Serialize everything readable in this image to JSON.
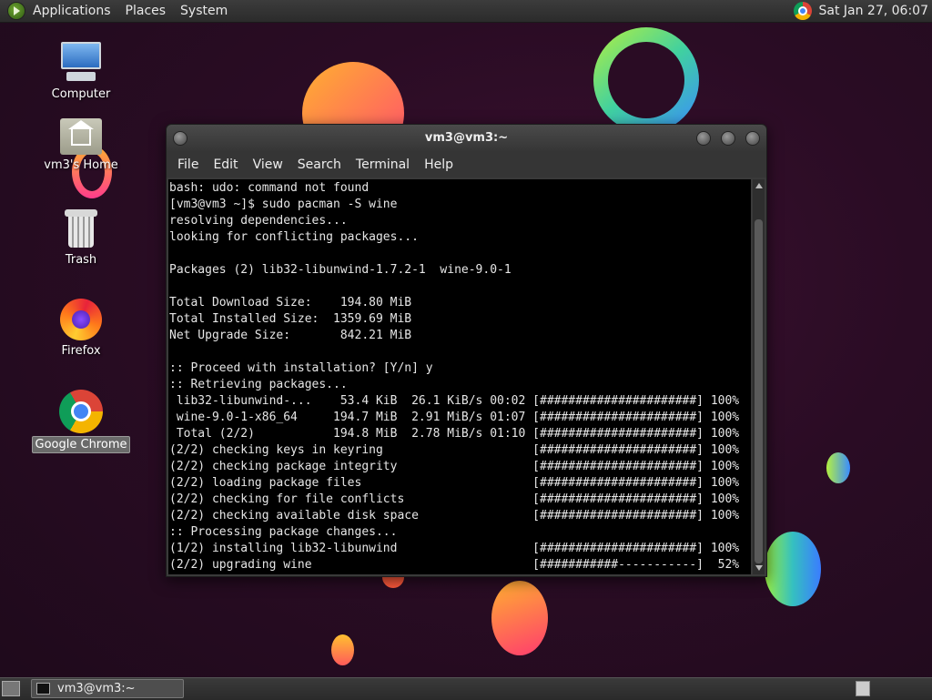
{
  "top_panel": {
    "menus": [
      "Applications",
      "Places",
      "System"
    ],
    "clock": "Sat Jan 27, 06:07"
  },
  "desktop": {
    "icons": [
      {
        "label": "Computer",
        "icon": "computer-icon"
      },
      {
        "label": "vm3's Home",
        "icon": "home-folder-icon"
      },
      {
        "label": "Trash",
        "icon": "trash-icon"
      },
      {
        "label": "Firefox",
        "icon": "firefox-icon"
      },
      {
        "label": "Google Chrome",
        "icon": "chrome-icon"
      }
    ]
  },
  "window": {
    "title": "vm3@vm3:~",
    "menu": [
      "File",
      "Edit",
      "View",
      "Search",
      "Terminal",
      "Help"
    ],
    "terminal_lines": [
      "bash: udo: command not found",
      "[vm3@vm3 ~]$ sudo pacman -S wine",
      "resolving dependencies...",
      "looking for conflicting packages...",
      "",
      "Packages (2) lib32-libunwind-1.7.2-1  wine-9.0-1",
      "",
      "Total Download Size:    194.80 MiB",
      "Total Installed Size:  1359.69 MiB",
      "Net Upgrade Size:       842.21 MiB",
      "",
      ":: Proceed with installation? [Y/n] y",
      ":: Retrieving packages...",
      " lib32-libunwind-...    53.4 KiB  26.1 KiB/s 00:02 [######################] 100%",
      " wine-9.0-1-x86_64     194.7 MiB  2.91 MiB/s 01:07 [######################] 100%",
      " Total (2/2)           194.8 MiB  2.78 MiB/s 01:10 [######################] 100%",
      "(2/2) checking keys in keyring                     [######################] 100%",
      "(2/2) checking package integrity                   [######################] 100%",
      "(2/2) loading package files                        [######################] 100%",
      "(2/2) checking for file conflicts                  [######################] 100%",
      "(2/2) checking available disk space                [######################] 100%",
      ":: Processing package changes...",
      "(1/2) installing lib32-libunwind                   [######################] 100%",
      "(2/2) upgrading wine                               [###########-----------]  52%"
    ]
  },
  "taskbar": {
    "tasks": [
      {
        "label": "vm3@vm3:~"
      }
    ]
  }
}
